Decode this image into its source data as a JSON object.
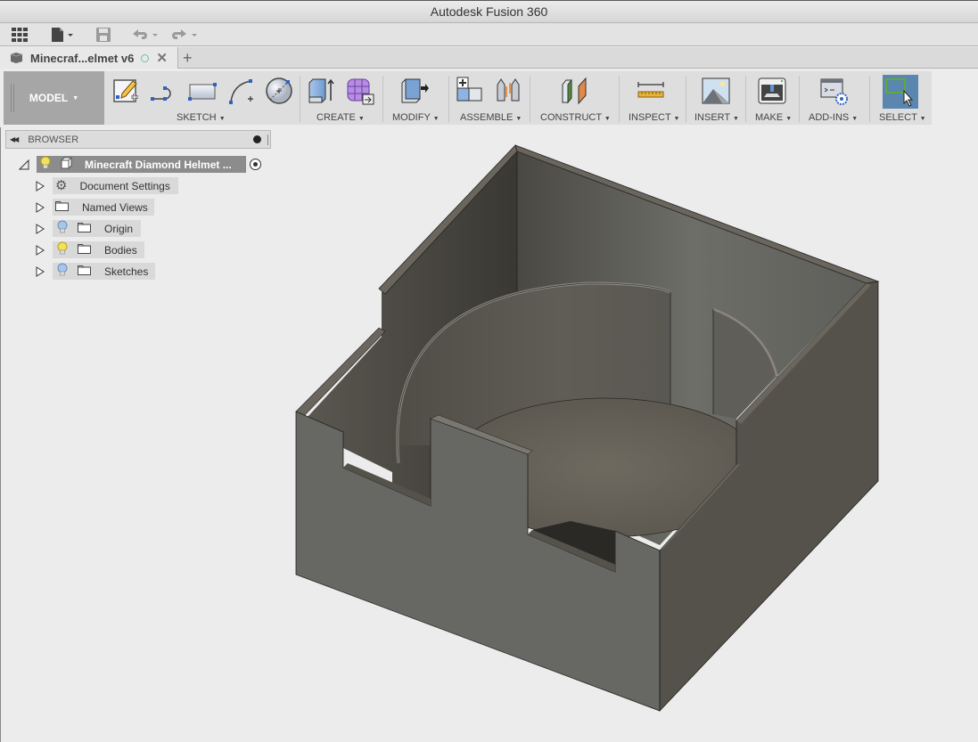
{
  "window": {
    "title": "Autodesk Fusion 360"
  },
  "quick_access": {
    "items": [
      {
        "name": "data-panel-icon"
      },
      {
        "name": "file-menu-icon"
      },
      {
        "name": "save-icon"
      },
      {
        "name": "undo-icon"
      },
      {
        "name": "redo-icon"
      }
    ]
  },
  "tabs": [
    {
      "label": "Minecraf...elmet v6",
      "icon": "document-cube-icon",
      "status": "unsaved-circle-icon"
    }
  ],
  "new_tab_label": "+",
  "workspace": {
    "label": "MODEL"
  },
  "toolbar": {
    "groups": [
      {
        "label": "SKETCH",
        "tools": [
          "create-sketch-icon",
          "line-icon",
          "rectangle-icon",
          "arc-icon",
          "circle-icon"
        ]
      },
      {
        "label": "CREATE",
        "tools": [
          "extrude-icon",
          "create-form-icon"
        ]
      },
      {
        "label": "MODIFY",
        "tools": [
          "press-pull-icon"
        ]
      },
      {
        "label": "ASSEMBLE",
        "tools": [
          "new-component-icon",
          "joint-icon"
        ]
      },
      {
        "label": "CONSTRUCT",
        "tools": [
          "offset-plane-icon"
        ]
      },
      {
        "label": "INSPECT",
        "tools": [
          "measure-icon"
        ]
      },
      {
        "label": "INSERT",
        "tools": [
          "insert-image-icon"
        ]
      },
      {
        "label": "MAKE",
        "tools": [
          "3d-print-icon"
        ]
      },
      {
        "label": "ADD-INS",
        "tools": [
          "scripts-addins-icon"
        ]
      },
      {
        "label": "SELECT",
        "tools": [
          "select-icon"
        ]
      }
    ]
  },
  "browser": {
    "title": "BROWSER",
    "root": {
      "label": "Minecraft Diamond Helmet ..."
    },
    "items": [
      {
        "label": "Document Settings",
        "icon": "gear-icon",
        "light": null
      },
      {
        "label": "Named Views",
        "icon": "folder-icon",
        "light": null
      },
      {
        "label": "Origin",
        "icon": "folder-icon",
        "light": "off"
      },
      {
        "label": "Bodies",
        "icon": "folder-icon",
        "light": "on"
      },
      {
        "label": "Sketches",
        "icon": "folder-icon",
        "light": "off"
      }
    ]
  },
  "colors": {
    "select_active": "#5a86b0",
    "body_front": "#676863",
    "body_side": "#55524b",
    "body_inner": "#5d5a52",
    "floor": "#6a665d",
    "bulb_on": "#f2e15a",
    "bulb_off": "#a8c6ec"
  }
}
